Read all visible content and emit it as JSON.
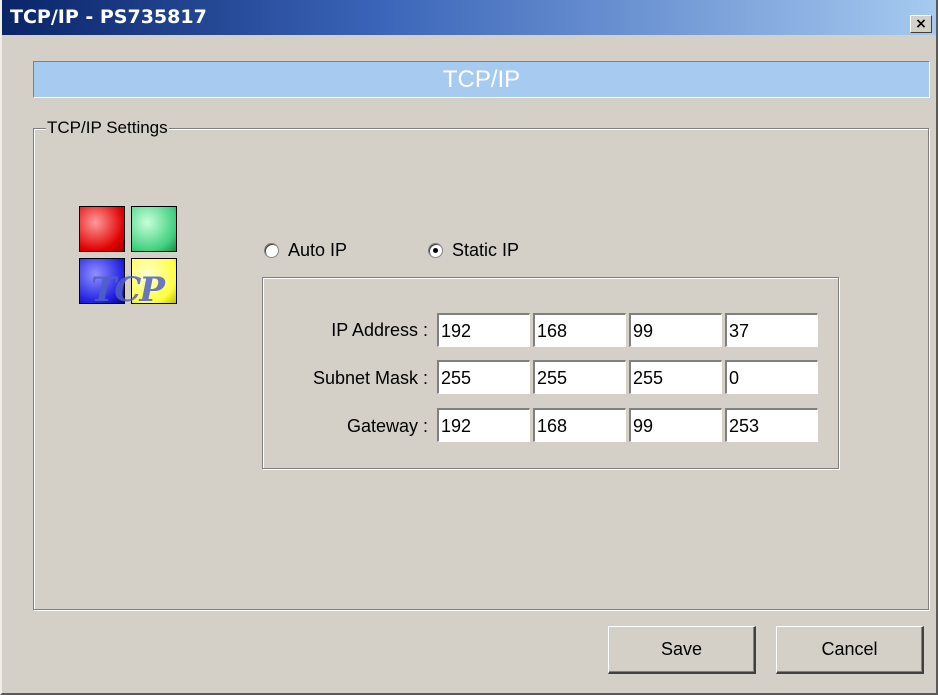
{
  "window": {
    "title": "TCP/IP - PS735817",
    "close_symbol": "×"
  },
  "header": {
    "title": "TCP/IP"
  },
  "settings": {
    "group_label": "TCP/IP Settings",
    "logo": {
      "icon": "tcp-logo-icon",
      "text": "TCP"
    },
    "mode_options": [
      {
        "label": "Auto IP",
        "selected": false
      },
      {
        "label": "Static IP",
        "selected": true
      }
    ],
    "rows": [
      {
        "label": "IP Address :",
        "octets": [
          "192",
          "168",
          "99",
          "37"
        ]
      },
      {
        "label": "Subnet Mask :",
        "octets": [
          "255",
          "255",
          "255",
          "0"
        ]
      },
      {
        "label": "Gateway :",
        "octets": [
          "192",
          "168",
          "99",
          "253"
        ]
      }
    ]
  },
  "buttons": {
    "save": "Save",
    "cancel": "Cancel"
  },
  "colors": {
    "title_gradient_start": "#0a2468",
    "title_gradient_end": "#a6caf0",
    "header_band": "#a6caf0",
    "window_bg": "#d4d0c8"
  }
}
